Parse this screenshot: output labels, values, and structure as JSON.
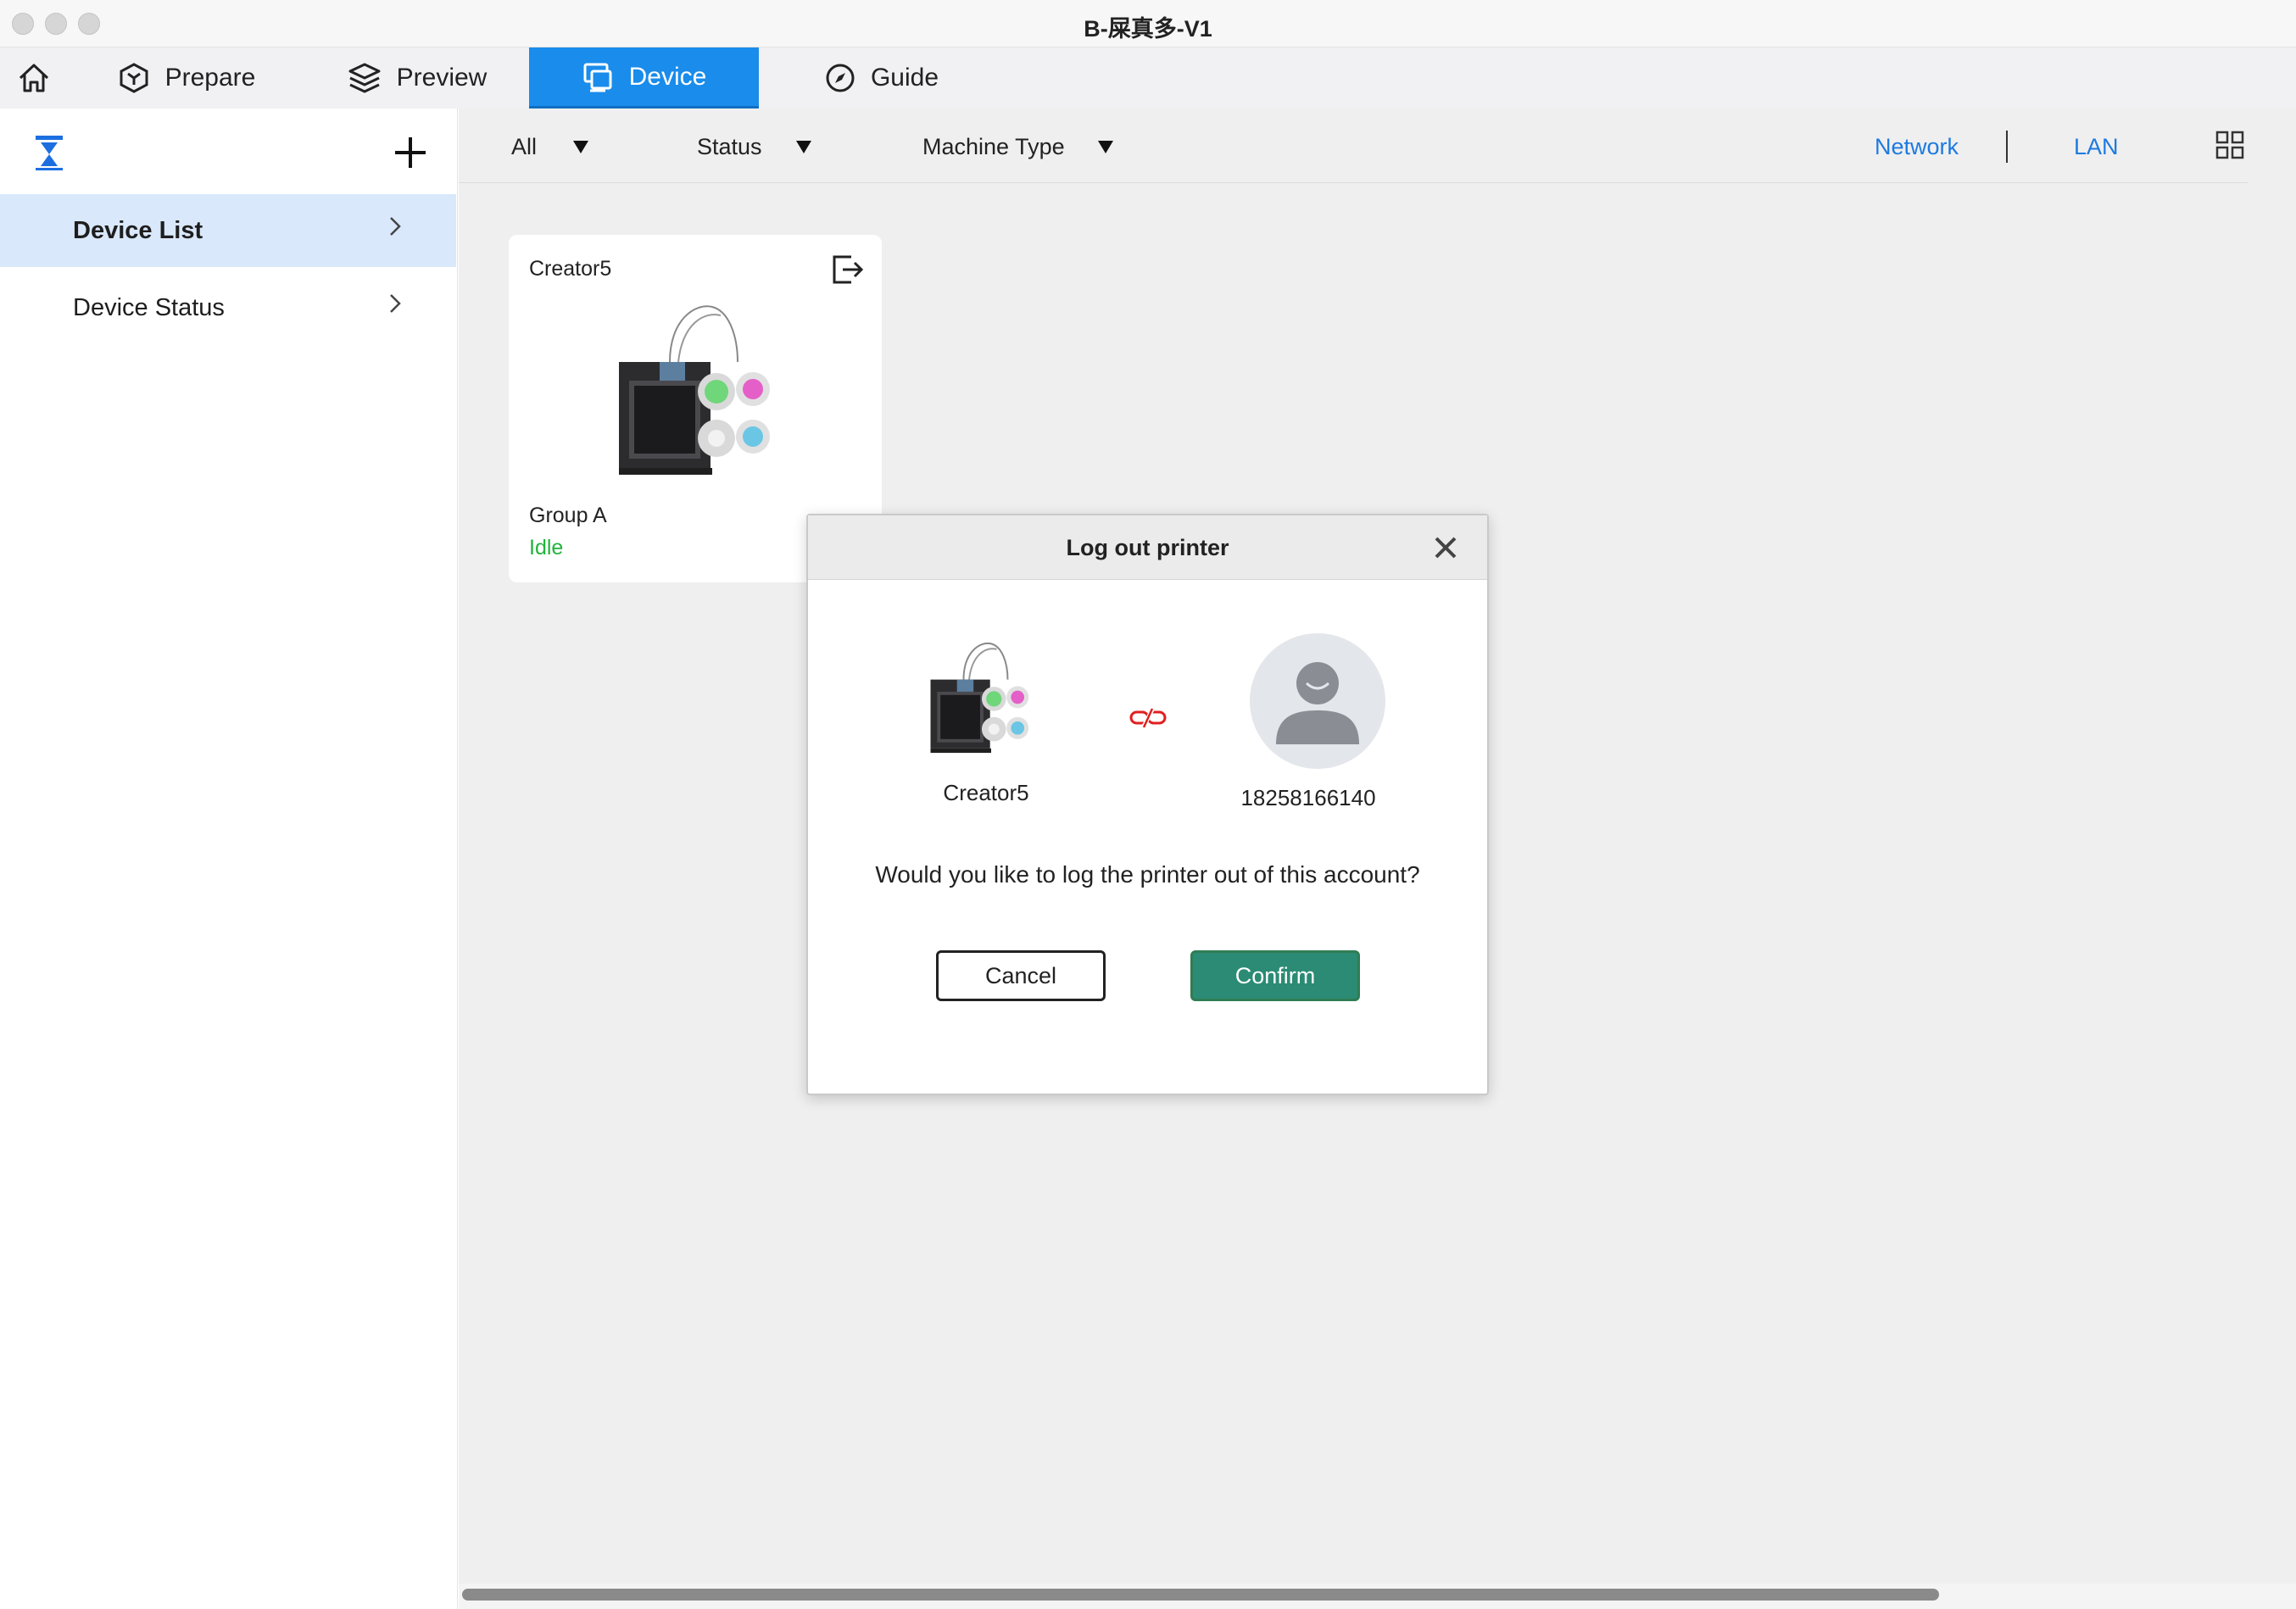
{
  "window": {
    "title": "B-屎真多-V1"
  },
  "tabs": [
    {
      "label": "Prepare",
      "icon": "prepare-icon"
    },
    {
      "label": "Preview",
      "icon": "layers-icon"
    },
    {
      "label": "Device",
      "icon": "device-icon",
      "active": true
    },
    {
      "label": "Guide",
      "icon": "compass-icon"
    }
  ],
  "sidebar": {
    "items": [
      {
        "label": "Device List",
        "selected": true
      },
      {
        "label": "Device Status",
        "selected": false
      }
    ]
  },
  "filters": {
    "all_label": "All",
    "status_label": "Status",
    "machine_type_label": "Machine Type",
    "network_label": "Network",
    "lan_label": "LAN"
  },
  "device_card": {
    "name": "Creator5",
    "group": "Group A",
    "status": "Idle"
  },
  "dialog": {
    "title": "Log out printer",
    "printer_name": "Creator5",
    "account_id": "18258166140",
    "question": "Would you like to log the printer out of this account?",
    "cancel_label": "Cancel",
    "confirm_label": "Confirm"
  },
  "colors": {
    "accent": "#1a8ceb",
    "link": "#1d7ae0",
    "status_idle": "#1fb43a",
    "confirm": "#2b8b74",
    "unlink": "#e02020"
  }
}
